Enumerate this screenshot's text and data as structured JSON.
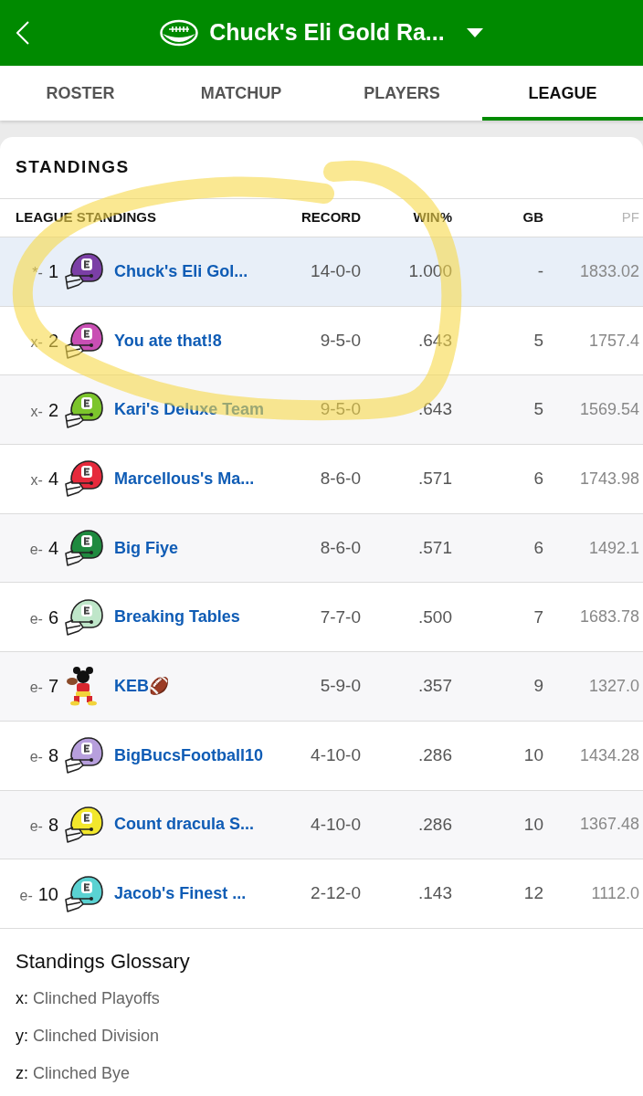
{
  "header": {
    "title": "Chuck's Eli Gold Ra..."
  },
  "tabs": [
    {
      "label": "ROSTER",
      "selected": false
    },
    {
      "label": "MATCHUP",
      "selected": false
    },
    {
      "label": "PLAYERS",
      "selected": false
    },
    {
      "label": "LEAGUE",
      "selected": true
    }
  ],
  "standings": {
    "title": "STANDINGS",
    "columns": [
      "LEAGUE STANDINGS",
      "RECORD",
      "WIN%",
      "GB",
      "PF"
    ],
    "rows": [
      {
        "clinch": "*-",
        "rank": "1",
        "kind": "helmet",
        "color": "#7b3fa6",
        "team": "Chuck's Eli Gol...",
        "record": "14-0-0",
        "win_pct": "1.000",
        "gb": "-",
        "pf": "1833.02",
        "selected": true
      },
      {
        "clinch": "x-",
        "rank": "2",
        "kind": "helmet",
        "color": "#c94fb4",
        "team": "You ate that!8",
        "record": "9-5-0",
        "win_pct": ".643",
        "gb": "5",
        "pf": "1757.4",
        "selected": false
      },
      {
        "clinch": "x-",
        "rank": "2",
        "kind": "helmet",
        "color": "#7cc52c",
        "team": "Kari's Deluxe Team",
        "record": "9-5-0",
        "win_pct": ".643",
        "gb": "5",
        "pf": "1569.54",
        "selected": false
      },
      {
        "clinch": "x-",
        "rank": "4",
        "kind": "helmet",
        "color": "#e62a3c",
        "team": "Marcellous's Ma...",
        "record": "8-6-0",
        "win_pct": ".571",
        "gb": "6",
        "pf": "1743.98",
        "selected": false
      },
      {
        "clinch": "e-",
        "rank": "4",
        "kind": "helmet",
        "color": "#1f8a3f",
        "team": "Big Fiye",
        "record": "8-6-0",
        "win_pct": ".571",
        "gb": "6",
        "pf": "1492.1",
        "selected": false
      },
      {
        "clinch": "e-",
        "rank": "6",
        "kind": "helmet",
        "color": "#bfe6c9",
        "team": "Breaking Tables",
        "record": "7-7-0",
        "win_pct": ".500",
        "gb": "7",
        "pf": "1683.78",
        "selected": false
      },
      {
        "clinch": "e-",
        "rank": "7",
        "kind": "avatar",
        "team": "KEB🏈",
        "record": "5-9-0",
        "win_pct": ".357",
        "gb": "9",
        "pf": "1327.0",
        "selected": false
      },
      {
        "clinch": "e-",
        "rank": "8",
        "kind": "helmet",
        "color": "#b79fdd",
        "team": "BigBucsFootball10",
        "record": "4-10-0",
        "win_pct": ".286",
        "gb": "10",
        "pf": "1434.28",
        "selected": false
      },
      {
        "clinch": "e-",
        "rank": "8",
        "kind": "helmet",
        "color": "#f2e72c",
        "team": "Count dracula S...",
        "record": "4-10-0",
        "win_pct": ".286",
        "gb": "10",
        "pf": "1367.48",
        "selected": false
      },
      {
        "clinch": "e-",
        "rank": "10",
        "kind": "helmet",
        "color": "#5ad2d2",
        "team": "Jacob's Finest ...",
        "record": "2-12-0",
        "win_pct": ".143",
        "gb": "12",
        "pf": "1112.0",
        "selected": false
      }
    ]
  },
  "glossary": {
    "title": "Standings Glossary",
    "items": [
      {
        "key": "x:",
        "label": "Clinched Playoffs"
      },
      {
        "key": "y:",
        "label": "Clinched Division"
      },
      {
        "key": "z:",
        "label": "Clinched Bye"
      }
    ]
  }
}
